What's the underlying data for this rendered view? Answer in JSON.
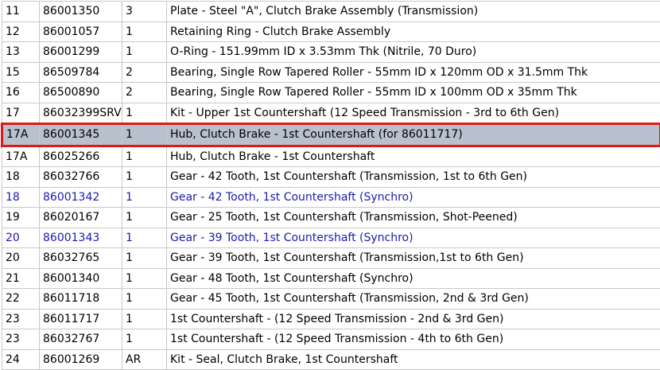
{
  "rows": [
    {
      "ref": "11",
      "part": "86001350",
      "qty": "3",
      "desc": "Plate - Steel \"A\", Clutch Brake Assembly (Transmission)",
      "link": false,
      "selected": false
    },
    {
      "ref": "12",
      "part": "86001057",
      "qty": "1",
      "desc": "Retaining Ring - Clutch Brake Assembly",
      "link": false,
      "selected": false
    },
    {
      "ref": "13",
      "part": "86001299",
      "qty": "1",
      "desc": "O-Ring - 151.99mm ID x 3.53mm Thk (Nitrile, 70 Duro)",
      "link": false,
      "selected": false
    },
    {
      "ref": "15",
      "part": "86509784",
      "qty": "2",
      "desc": "Bearing, Single Row Tapered Roller - 55mm ID x 120mm OD x 31.5mm Thk",
      "link": false,
      "selected": false
    },
    {
      "ref": "16",
      "part": "86500890",
      "qty": "2",
      "desc": "Bearing, Single Row Tapered Roller - 55mm ID x 100mm OD x 35mm Thk",
      "link": false,
      "selected": false
    },
    {
      "ref": "17",
      "part": "86032399SRV",
      "qty": "1",
      "desc": "Kit - Upper 1st Countershaft (12 Speed Transmission - 3rd to 6th Gen)",
      "link": false,
      "selected": false
    },
    {
      "ref": "17A",
      "part": "86001345",
      "qty": "1",
      "desc": "Hub, Clutch Brake - 1st Countershaft (for 86011717)",
      "link": false,
      "selected": true
    },
    {
      "ref": "17A",
      "part": "86025266",
      "qty": "1",
      "desc": "Hub, Clutch Brake - 1st Countershaft",
      "link": false,
      "selected": false
    },
    {
      "ref": "18",
      "part": "86032766",
      "qty": "1",
      "desc": "Gear - 42 Tooth, 1st Countershaft (Transmission, 1st to 6th Gen)",
      "link": false,
      "selected": false
    },
    {
      "ref": "18",
      "part": "86001342",
      "qty": "1",
      "desc": "Gear - 42 Tooth, 1st Countershaft (Synchro)",
      "link": true,
      "selected": false
    },
    {
      "ref": "19",
      "part": "86020167",
      "qty": "1",
      "desc": "Gear - 25 Tooth, 1st Countershaft (Transmission, Shot-Peened)",
      "link": false,
      "selected": false
    },
    {
      "ref": "20",
      "part": "86001343",
      "qty": "1",
      "desc": "Gear - 39 Tooth, 1st Countershaft (Synchro)",
      "link": true,
      "selected": false
    },
    {
      "ref": "20",
      "part": "86032765",
      "qty": "1",
      "desc": "Gear - 39 Tooth, 1st Countershaft (Transmission,1st to 6th Gen)",
      "link": false,
      "selected": false
    },
    {
      "ref": "21",
      "part": "86001340",
      "qty": "1",
      "desc": "Gear - 48 Tooth, 1st Countershaft (Synchro)",
      "link": false,
      "selected": false
    },
    {
      "ref": "22",
      "part": "86011718",
      "qty": "1",
      "desc": "Gear - 45 Tooth, 1st Countershaft (Transmission, 2nd & 3rd Gen)",
      "link": false,
      "selected": false
    },
    {
      "ref": "23",
      "part": "86011717",
      "qty": "1",
      "desc": "1st Countershaft - (12 Speed Transmission - 2nd & 3rd Gen)",
      "link": false,
      "selected": false
    },
    {
      "ref": "23",
      "part": "86032767",
      "qty": "1",
      "desc": "1st Countershaft - (12 Speed Transmission - 4th to 6th Gen)",
      "link": false,
      "selected": false
    },
    {
      "ref": "24",
      "part": "86001269",
      "qty": "AR",
      "desc": "Kit - Seal, Clutch Brake, 1st Countershaft",
      "link": false,
      "selected": false
    }
  ],
  "colors": {
    "link_text": "#1a1ab0",
    "selected_background": "#b9c1cf",
    "selected_outline": "#e01818",
    "grid_line": "#c8c8c8"
  }
}
